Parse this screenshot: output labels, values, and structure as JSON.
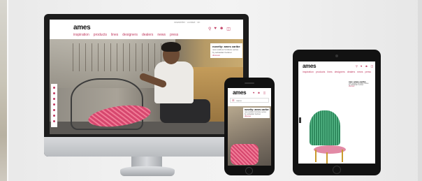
{
  "brand": {
    "logo": "ames",
    "accent": "#c0395f"
  },
  "desktop": {
    "top_note": "newsletter · contact · en",
    "nav": [
      "inspiration",
      "products",
      "lines",
      "designers",
      "dealers",
      "news",
      "press"
    ],
    "icons": [
      "search-icon",
      "heart-icon",
      "user-icon",
      "cart-icon"
    ],
    "promo": {
      "title": "novelty: ames caribe",
      "subtitle": "new outdoor furniture series",
      "subtitle2": "by sebastian herkner",
      "link": "discover"
    }
  },
  "phone": {
    "logo": "ames",
    "menu_label": "menu",
    "promo": {
      "title": "novelty: ames caribe",
      "subtitle": "new outdoor furniture series",
      "subtitle2": "by sebastian herkner",
      "link": "discover"
    }
  },
  "tablet": {
    "logo": "ames",
    "nav": [
      "inspiration",
      "products",
      "lines",
      "designers",
      "dealers",
      "news",
      "press"
    ],
    "promo": {
      "title": "neu: ames caribe",
      "subtitle": "new outdoor furniture series",
      "subtitle2": "by sebastian herkner",
      "link": "discover"
    }
  }
}
